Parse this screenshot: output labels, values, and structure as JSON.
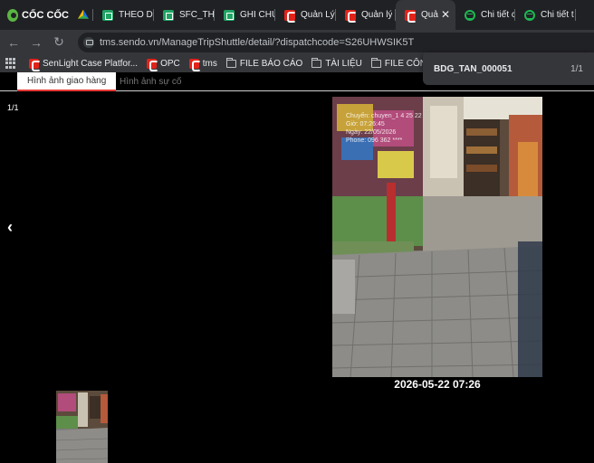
{
  "browser": {
    "brand": "CỐC CỐC",
    "tabs": [
      {
        "title": "",
        "icon": "google-drive-icon",
        "active": false
      },
      {
        "title": "THEO DÕ",
        "icon": "google-sheets-icon",
        "active": false
      },
      {
        "title": "SFC_THE",
        "icon": "google-sheets-icon",
        "active": false
      },
      {
        "title": "GHI CHÚ",
        "icon": "google-sheets-icon",
        "active": false
      },
      {
        "title": "Quản Lý",
        "icon": "sendo-icon",
        "active": false
      },
      {
        "title": "Quản lý",
        "icon": "sendo-icon",
        "active": false
      },
      {
        "title": "Quả",
        "icon": "sendo-icon",
        "active": true
      },
      {
        "title": "Chi tiết c",
        "icon": "green-circle-icon",
        "active": false
      },
      {
        "title": "Chi tiết t",
        "icon": "green-circle-icon",
        "active": false
      }
    ],
    "url": "tms.sendo.vn/ManageTripShuttle/detail/?dispatchcode=S26UHWSIK5T",
    "bookmarks": [
      {
        "label": "SenLight Case Platfor...",
        "icon": "sendo-icon"
      },
      {
        "label": "OPC",
        "icon": "sendo-icon"
      },
      {
        "label": "tms",
        "icon": "sendo-icon"
      },
      {
        "label": "FILE BÁO CÁO",
        "icon": "folder-icon"
      },
      {
        "label": "TÀI LIỆU",
        "icon": "folder-icon"
      },
      {
        "label": "FILE CÔNG VIỆC",
        "icon": "folder-icon"
      }
    ],
    "find": {
      "query": "BDG_TAN_000051",
      "count": "1/1"
    }
  },
  "page": {
    "tabs": {
      "delivery": "Hình ảnh giao hàng",
      "incident": "Hình ảnh sự cố"
    },
    "counter": "1/1",
    "prev_arrow": "‹",
    "photo": {
      "stamp_lines": [
        "Chuyến: chuyen_1 4 25 22",
        "Giờ: 07:26:45",
        "Ngày: 22/05/2026",
        "Phone: 096 362 ****"
      ],
      "caption": "2026-05-22 07:26"
    }
  },
  "colors": {
    "accent": "#e53935",
    "tab_strip": "#202124",
    "toolbar": "#35363a"
  }
}
